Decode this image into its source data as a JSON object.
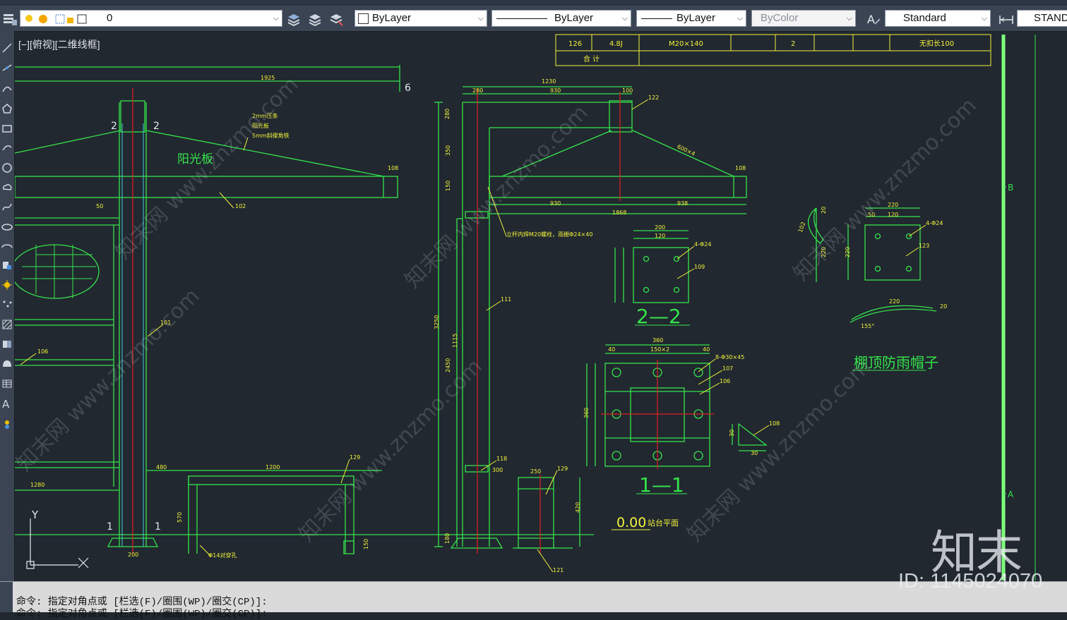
{
  "toolbar": {
    "layer_name": "0",
    "color": "ByLayer",
    "linetype": "ByLayer",
    "lineweight": "ByLayer",
    "plotstyle": "ByColor",
    "textstyle": "Standard",
    "dimstyle": "STAND"
  },
  "viewport": {
    "label": "[−][俯视][二维线框]"
  },
  "table": {
    "row1": [
      "126",
      "4.8J",
      "M20×140",
      "2",
      "无扣长100"
    ],
    "row2_label": "合  计"
  },
  "drawing": {
    "dims": {
      "d1925": "1925",
      "d1230": "1230",
      "d280": "280",
      "d930": "930",
      "d100": "100",
      "d122": "122",
      "d108": "108",
      "d102": "102",
      "d50": "50",
      "d101": "101",
      "d106": "106",
      "d480": "480",
      "d1200": "1200",
      "d129": "129",
      "d1280": "1280",
      "d570": "570",
      "d150": "150",
      "d280b": "280",
      "d350": "350",
      "d150b": "150",
      "d3250": "3250",
      "d2450": "2450",
      "d1115": "1115",
      "d180": "180",
      "d930a": "930",
      "d938": "938",
      "d1868": "1868",
      "d600": "600×4",
      "d111": "111",
      "d118": "118",
      "d300": "300",
      "d250": "250",
      "d129b": "129",
      "d420": "420",
      "d121": "121",
      "d200": "200",
      "d120": "120",
      "d4phi24": "4-Φ24",
      "d109": "109",
      "d360": "360",
      "d40": "40",
      "d150x2": "150×2",
      "d8phi30": "8-Φ30×45",
      "d107": "107",
      "d120b": "120",
      "d102b": "102",
      "d220": "220",
      "d4phi24b": "4-Φ24",
      "d123": "123",
      "d155": "155°",
      "d108b": "108",
      "d30": "30",
      "d20": "20"
    },
    "notes": {
      "bracket1": "2mm压条",
      "bracket2": "阳光板",
      "bracket3": "5mm斜撑角铁",
      "sunboard": "阳光板",
      "bolt_note": "立杆内焊M20螺栓，雨棚Φ24×40",
      "hole_note": "Φ14对穿孔",
      "level": "0.00",
      "level_note": "站台平面",
      "sec22": "2—2",
      "sec11": "1—1",
      "cap_title": "棚顶防雨帽子",
      "grid_a": "A",
      "grid_b": "B",
      "cut1": "1",
      "cut2": "2",
      "cut6": "6"
    }
  },
  "command": {
    "line1": "命令: 指定对角点或 [栏选(F)/圈围(WP)/圈交(CP)]:",
    "line2": "命令: 指定对角点或 [栏选(F)/圈围(WP)/圈交(CP)]:"
  },
  "watermark": {
    "logo": "知末",
    "id": "ID: 1145024070",
    "diag": "知末网 www.znzmo.com"
  },
  "colors": {
    "cad_green": "#35e34a",
    "cad_yellow": "#f2f23a",
    "cad_red": "#e02020",
    "cad_cyan": "#3fd0d6",
    "bg": "#212830"
  }
}
